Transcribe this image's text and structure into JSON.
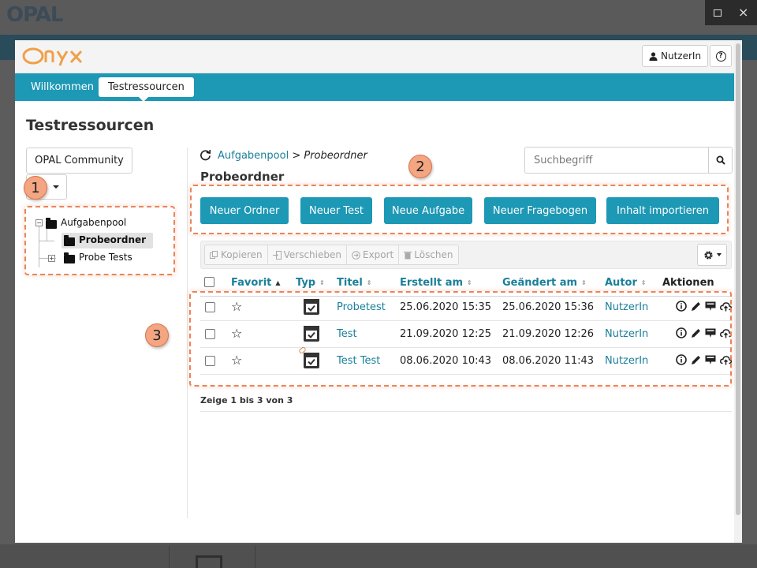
{
  "window": {
    "maximize_icon": "window-maximize-icon",
    "close_icon": "×"
  },
  "background": {
    "logo": "OPAL"
  },
  "header": {
    "logo": "Onyx",
    "user_label": "NutzerIn",
    "help_icon": "?"
  },
  "nav": {
    "tabs": [
      {
        "label": "Willkommen"
      },
      {
        "label": "Testressourcen",
        "active": true
      }
    ]
  },
  "page": {
    "title": "Testressourcen"
  },
  "left": {
    "community_label": "OPAL Community",
    "tree": [
      {
        "label": "Aufgabenpool",
        "expander": "−"
      },
      {
        "label": "Probeordner",
        "selected": true
      },
      {
        "label": "Probe Tests",
        "expander": "+"
      }
    ]
  },
  "right": {
    "breadcrumb": {
      "root": "Aufgabenpool",
      "separator": " > ",
      "current": "Probeordner"
    },
    "folder_title": "Probeordner",
    "search_placeholder": "Suchbegriff",
    "actions": [
      "Neuer Ordner",
      "Neuer Test",
      "Neue Aufgabe",
      "Neuer Fragebogen",
      "Inhalt importieren"
    ],
    "toolbar": [
      "Kopieren",
      "Verschieben",
      "Export",
      "Löschen"
    ],
    "table": {
      "columns": [
        "Favorit",
        "Typ",
        "Titel",
        "Erstellt am",
        "Geändert am",
        "Autor",
        "Aktionen"
      ],
      "rows": [
        {
          "title": "Probetest",
          "created": "25.06.2020 15:35",
          "modified": "25.06.2020 15:36",
          "author": "NutzerIn"
        },
        {
          "title": "Test",
          "created": "21.09.2020 12:25",
          "modified": "21.09.2020 12:26",
          "author": "NutzerIn"
        },
        {
          "title": "Test Test",
          "created": "08.06.2020 10:43",
          "modified": "08.06.2020 11:43",
          "author": "NutzerIn",
          "linked": true
        }
      ]
    },
    "summary": "Zeige 1 bis 3 von 3"
  },
  "callouts": [
    "1",
    "2",
    "3"
  ],
  "colors": {
    "primary": "#1d98b5",
    "link": "#1a7f9a",
    "callout": "#e8855a",
    "logo": "#f0a04b"
  }
}
